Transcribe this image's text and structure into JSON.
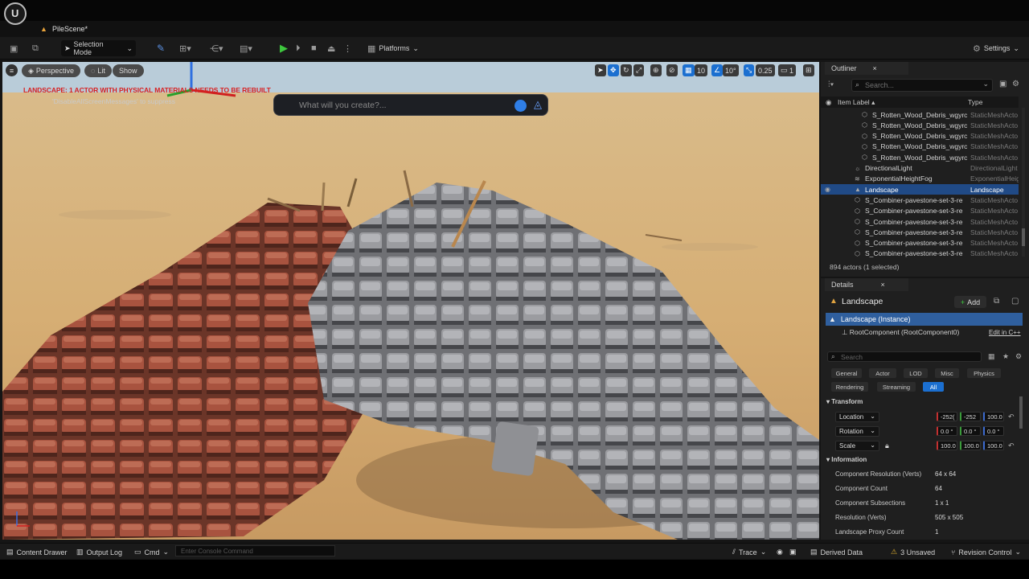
{
  "window": {
    "tab_title": "PileScene*"
  },
  "toolbar": {
    "selection_mode": "Selection Mode",
    "platforms": "Platforms",
    "settings": "Settings"
  },
  "viewport": {
    "perspective": "Perspective",
    "lit": "Lit",
    "show": "Show",
    "warning": "LANDSCAPE: 1 ACTOR WITH PHYSICAL MATERIALS NEEDS TO BE REBUILT",
    "warning_sub": "'DisableAllScreenMessages' to suppress",
    "prompt_placeholder": "What will you create?...",
    "grid_snap": "10",
    "rotation_snap": "10°",
    "scale_snap": "0.25",
    "camera_speed": "1"
  },
  "outliner": {
    "title": "Outliner",
    "search_placeholder": "Search...",
    "col_label": "Item Label",
    "col_type": "Type",
    "rows": [
      {
        "name": "S_Rotten_Wood_Debris_wgyrc",
        "type": "StaticMeshActo"
      },
      {
        "name": "S_Rotten_Wood_Debris_wgyrc",
        "type": "StaticMeshActo"
      },
      {
        "name": "S_Rotten_Wood_Debris_wgyrc",
        "type": "StaticMeshActo"
      },
      {
        "name": "S_Rotten_Wood_Debris_wgyrc",
        "type": "StaticMeshActo"
      },
      {
        "name": "S_Rotten_Wood_Debris_wgyrc",
        "type": "StaticMeshActo"
      },
      {
        "name": "DirectionalLight",
        "type": "DirectionalLight"
      },
      {
        "name": "ExponentialHeightFog",
        "type": "ExponentialHeig"
      },
      {
        "name": "Landscape",
        "type": "Landscape"
      },
      {
        "name": "S_Combiner-pavestone-set-3-re",
        "type": "StaticMeshActo"
      },
      {
        "name": "S_Combiner-pavestone-set-3-re",
        "type": "StaticMeshActo"
      },
      {
        "name": "S_Combiner-pavestone-set-3-re",
        "type": "StaticMeshActo"
      },
      {
        "name": "S_Combiner-pavestone-set-3-re",
        "type": "StaticMeshActo"
      },
      {
        "name": "S_Combiner-pavestone-set-3-re",
        "type": "StaticMeshActo"
      },
      {
        "name": "S_Combiner-pavestone-set-3-re",
        "type": "StaticMeshActo"
      }
    ],
    "count": "894 actors (1 selected)"
  },
  "details": {
    "title": "Details",
    "actor_name": "Landscape",
    "add": "Add",
    "instance": "Landscape (Instance)",
    "root_component": "RootComponent (RootComponent0)",
    "edit_in_cpp": "Edit in C++",
    "search_placeholder": "Search",
    "filters": [
      "General",
      "Actor",
      "LOD",
      "Misc",
      "Physics",
      "Rendering",
      "Streaming",
      "All"
    ],
    "transform_label": "Transform",
    "location": {
      "label": "Location",
      "x": "-252(",
      "y": "-252",
      "z": "100.0"
    },
    "rotation": {
      "label": "Rotation",
      "x": "0.0 °",
      "y": "0.0 °",
      "z": "0.0 °"
    },
    "scale": {
      "label": "Scale",
      "x": "100.0",
      "y": "100.0",
      "z": "100.0"
    },
    "information_label": "Information",
    "info": [
      {
        "label": "Component Resolution (Verts)",
        "value": "64 x 64"
      },
      {
        "label": "Component Count",
        "value": "64"
      },
      {
        "label": "Component Subsections",
        "value": "1 x 1"
      },
      {
        "label": "Resolution (Verts)",
        "value": "505 x 505"
      },
      {
        "label": "Landscape Proxy Count",
        "value": "1"
      }
    ]
  },
  "statusbar": {
    "content_drawer": "Content Drawer",
    "output_log": "Output Log",
    "cmd": "Cmd",
    "console_placeholder": "Enter Console Command",
    "trace": "Trace",
    "derived_data": "Derived Data",
    "unsaved": "3 Unsaved",
    "revision_control": "Revision Control"
  }
}
